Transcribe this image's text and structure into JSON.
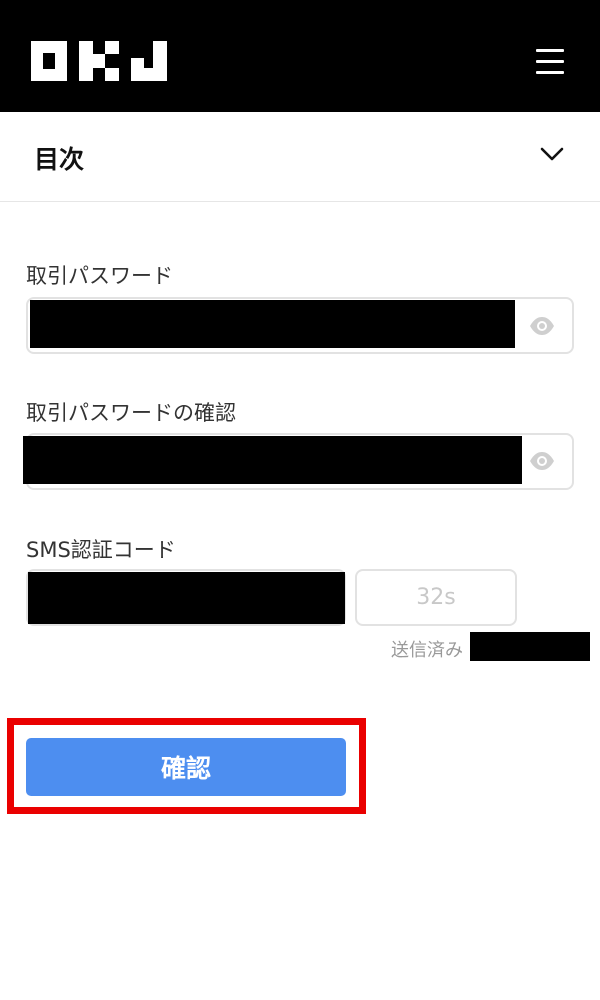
{
  "header": {
    "logo_icon": "okj-logo",
    "menu_icon": "hamburger-menu-icon",
    "background": "#000000"
  },
  "toc": {
    "title": "目次",
    "icon": "chevron-down-icon"
  },
  "form": {
    "password_label": "取引パスワード",
    "password_confirm_label": "取引パスワードの確認",
    "sms_label": "SMS認証コード",
    "resend_label": "32s",
    "sent_label": "送信済み",
    "visibility_icon": "eye-icon"
  },
  "confirm": {
    "label": "確認",
    "color": "#4d8ef0",
    "highlight_color": "#ea0000"
  }
}
